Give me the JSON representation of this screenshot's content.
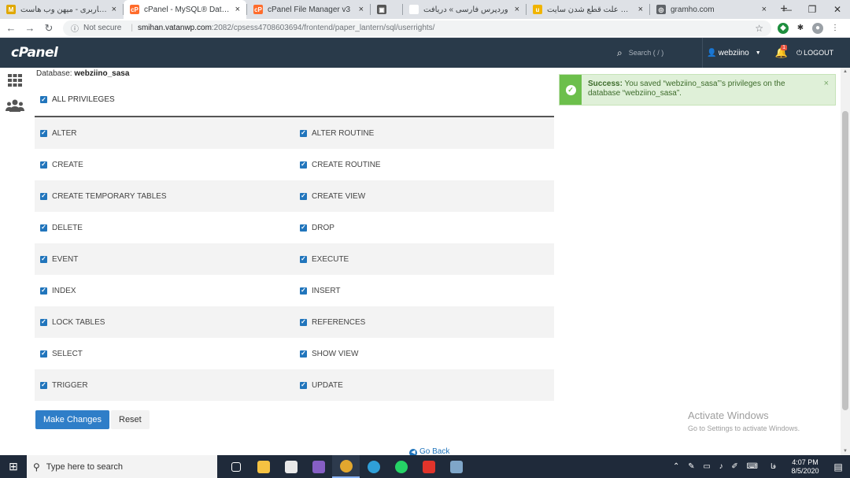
{
  "browser": {
    "tabs": [
      {
        "label": "ناحیه کاربری - میهن وب هاست",
        "color": "#e0a800",
        "glyph": "M"
      },
      {
        "label": "cPanel - MySQL® Databases",
        "color": "#ff6c2c",
        "glyph": "cP",
        "active": true
      },
      {
        "label": "cPanel File Manager v3",
        "color": "#ff6c2c",
        "glyph": "cP"
      },
      {
        "label": "",
        "color": "#555555",
        "glyph": "▣"
      },
      {
        "label": "وردپرس فارسی » دریافت",
        "color": "#ffffff",
        "glyph": ""
      },
      {
        "label": "بررسی علت قطع شدن سایت",
        "color": "#f0b400",
        "glyph": "u"
      },
      {
        "label": "gramho.com",
        "color": "#5f6368",
        "glyph": "◎"
      }
    ],
    "not_secure": "Not secure",
    "url_host": "smihan.vatanwp.com",
    "url_path": ":2082/cpsess4708603694/frontend/paper_lantern/sql/userrights/"
  },
  "header": {
    "logo": "cPanel",
    "search_placeholder": "Search ( / )",
    "username": "webziino",
    "bell_badge": "1",
    "logout": "LOGOUT"
  },
  "main": {
    "database_label": "Database:",
    "database_name": "webziino_sasa",
    "all_privileges": "ALL PRIVILEGES",
    "privileges": [
      [
        "ALTER",
        "ALTER ROUTINE"
      ],
      [
        "CREATE",
        "CREATE ROUTINE"
      ],
      [
        "CREATE TEMPORARY TABLES",
        "CREATE VIEW"
      ],
      [
        "DELETE",
        "DROP"
      ],
      [
        "EVENT",
        "EXECUTE"
      ],
      [
        "INDEX",
        "INSERT"
      ],
      [
        "LOCK TABLES",
        "REFERENCES"
      ],
      [
        "SELECT",
        "SHOW VIEW"
      ],
      [
        "TRIGGER",
        "UPDATE"
      ]
    ],
    "make_changes": "Make Changes",
    "reset": "Reset",
    "go_back": "Go Back"
  },
  "alert": {
    "strong": "Success:",
    "message": "You saved “webziino_sasa”’s privileges on the database “webziino_sasa”."
  },
  "activate": {
    "line1": "Activate Windows",
    "line2": "Go to Settings to activate Windows."
  },
  "taskbar": {
    "search_placeholder": "Type here to search",
    "time": "4:07 PM",
    "date": "8/5/2020",
    "lang": "فا"
  }
}
